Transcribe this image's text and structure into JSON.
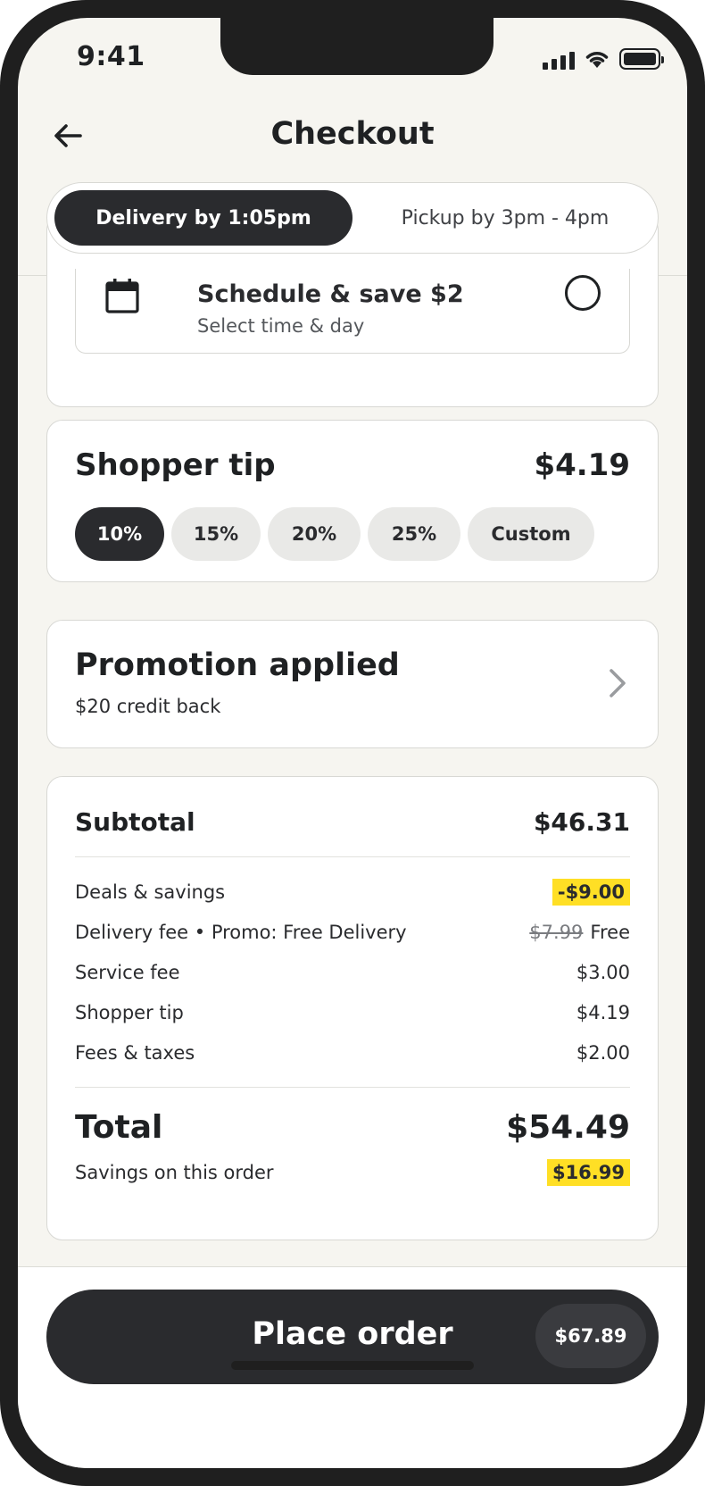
{
  "status_bar": {
    "time": "9:41"
  },
  "header": {
    "title": "Checkout",
    "back_icon": "arrow-left-icon"
  },
  "fulfillment_tabs": [
    {
      "label": "Delivery by 1:05pm",
      "selected": true
    },
    {
      "label": "Pickup by 3pm - 4pm",
      "selected": false
    }
  ],
  "schedule": {
    "title": "Schedule & save $2",
    "subtitle": "Select time & day",
    "icon": "calendar-icon",
    "selected": false
  },
  "tip": {
    "title": "Shopper tip",
    "amount": "$4.19",
    "options": [
      {
        "label": "10%",
        "selected": true
      },
      {
        "label": "15%",
        "selected": false
      },
      {
        "label": "20%",
        "selected": false
      },
      {
        "label": "25%",
        "selected": false
      },
      {
        "label": "Custom",
        "selected": false
      }
    ]
  },
  "promotion": {
    "title": "Promotion applied",
    "subtitle": "$20 credit back",
    "icon": "chevron-right-icon"
  },
  "summary": {
    "subtotal_label": "Subtotal",
    "subtotal_value": "$46.31",
    "lines": [
      {
        "label": "Deals & savings",
        "value": "-$9.00",
        "highlight": true
      },
      {
        "label": "Delivery fee • Promo: Free Delivery",
        "original": "$7.99",
        "value": "Free"
      },
      {
        "label": "Service fee",
        "value": "$3.00"
      },
      {
        "label": "Shopper tip",
        "value": "$4.19"
      },
      {
        "label": "Fees & taxes",
        "value": "$2.00"
      }
    ],
    "total_label": "Total",
    "total_value": "$54.49",
    "savings_label": "Savings on this order",
    "savings_value": "$16.99"
  },
  "place_order": {
    "label": "Place order",
    "price": "$67.89"
  },
  "colors": {
    "dark": "#2a2b2e",
    "highlight": "#ffdf25",
    "background": "#f6f5f0"
  }
}
